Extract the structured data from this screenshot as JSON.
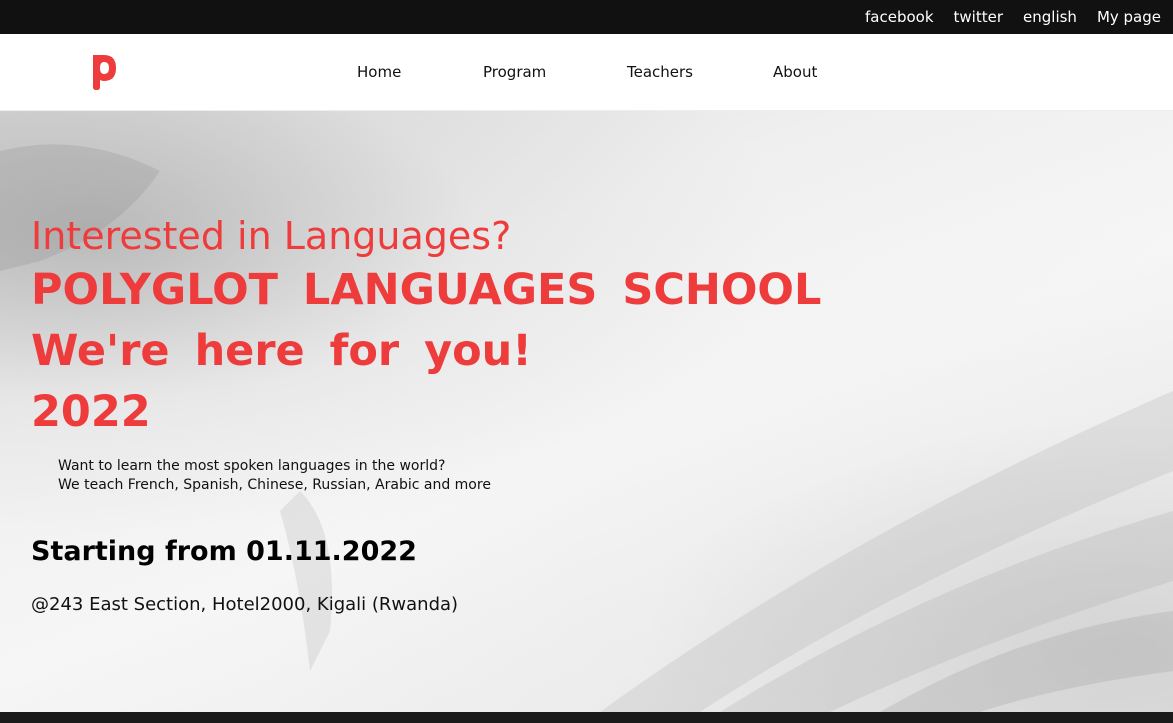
{
  "topbar": {
    "links": [
      "facebook",
      "twitter",
      "english",
      "My page"
    ]
  },
  "nav": {
    "items": [
      "Home",
      "Program",
      "Teachers",
      "About"
    ]
  },
  "brand": {
    "logo_icon": "polyglot-p-logo",
    "accent_color": "#ee3b3b"
  },
  "hero": {
    "tagline": "Interested in Languages?",
    "title": "POLYGLOT LANGUAGES SCHOOL",
    "subtitle": "We're here for you!",
    "year": "2022",
    "description_line1": "Want to learn the most spoken languages in the world?",
    "description_line2": "We teach French, Spanish, Chinese, Russian, Arabic and more",
    "start_date": "Starting from 01.11.2022",
    "address": "@243 East Section, Hotel2000, Kigali (Rwanda)"
  }
}
